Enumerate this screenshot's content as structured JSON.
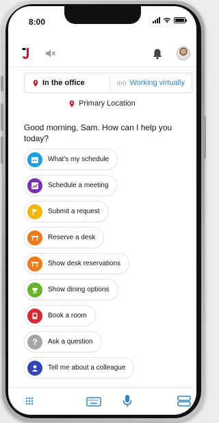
{
  "status_bar": {
    "time": "8:00"
  },
  "location": {
    "office_label": "In the office",
    "virtual_label": "Working virtually",
    "primary_label": "Primary Location"
  },
  "greeting": "Good morning, Sam. How can I help you today?",
  "suggestions": [
    {
      "label": "What's my schedule",
      "icon": "calendar-icon",
      "color": "#1e9fe0"
    },
    {
      "label": "Schedule a meeting",
      "icon": "chart-icon",
      "color": "#7b2fb5"
    },
    {
      "label": "Submit a request",
      "icon": "flag-icon",
      "color": "#f2b705"
    },
    {
      "label": "Reserve a desk",
      "icon": "desk-icon",
      "color": "#f07b1a"
    },
    {
      "label": "Show desk reservations",
      "icon": "desk-icon",
      "color": "#f07b1a"
    },
    {
      "label": "Show dining options",
      "icon": "dining-icon",
      "color": "#6ab42d"
    },
    {
      "label": "Book a room",
      "icon": "room-icon",
      "color": "#d92835"
    },
    {
      "label": "Ask a question",
      "icon": "question-icon",
      "color": "#a6a6a6"
    },
    {
      "label": "Tell me about a colleague",
      "icon": "person-icon",
      "color": "#3246b5"
    }
  ],
  "colors": {
    "accent": "#2b87c9",
    "brand_red": "#d1142a"
  }
}
